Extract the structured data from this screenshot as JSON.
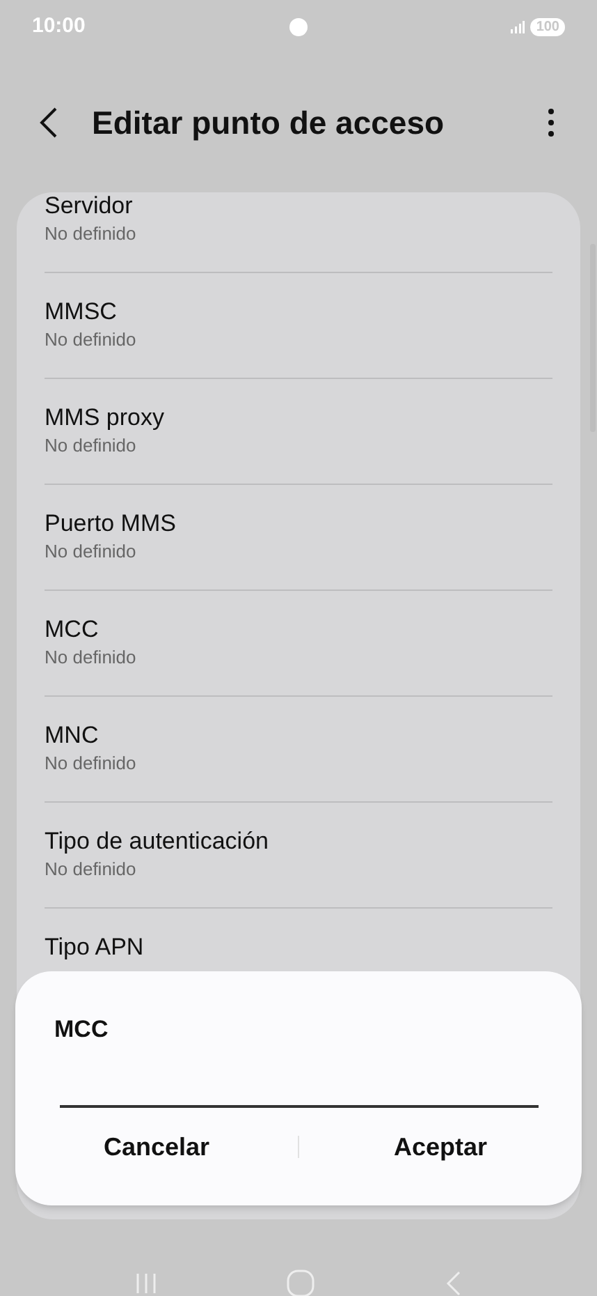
{
  "status_bar": {
    "time": "10:00",
    "battery": "100"
  },
  "header": {
    "title": "Editar punto de acceso"
  },
  "settings": [
    {
      "label": "Servidor",
      "value": "No definido"
    },
    {
      "label": "MMSC",
      "value": "No definido"
    },
    {
      "label": "MMS proxy",
      "value": "No definido"
    },
    {
      "label": "Puerto MMS",
      "value": "No definido"
    },
    {
      "label": "MCC",
      "value": "No definido"
    },
    {
      "label": "MNC",
      "value": "No definido"
    },
    {
      "label": "Tipo de autenticación",
      "value": "No definido"
    },
    {
      "label": "Tipo APN"
    }
  ],
  "dialog": {
    "title": "MCC",
    "buttons": [
      "Cancelar",
      "Aceptar"
    ]
  }
}
